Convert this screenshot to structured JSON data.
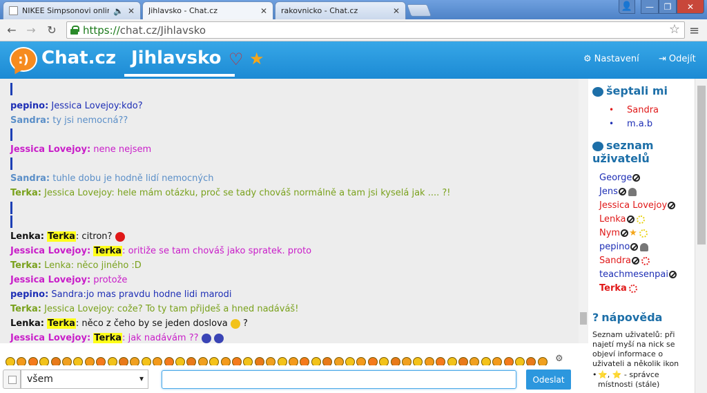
{
  "browser": {
    "tabs": [
      {
        "title": "NIKEE Simpsonovi online l"
      },
      {
        "title": "Jihlavsko - Chat.cz"
      },
      {
        "title": "rakovnicko - Chat.cz"
      }
    ],
    "url_scheme": "https://",
    "url_rest": "chat.cz/Jihlavsko"
  },
  "header": {
    "logo_symbol": ":)",
    "logo": "Chat.cz",
    "room": "Jihlavsko",
    "settings": "Nastavení",
    "logout": "Odejít"
  },
  "colors": {
    "header": "#1c8ad4",
    "pepino": "#1d2eb5",
    "sandra": "#5b8fc8",
    "jessica": "#c91ec9",
    "terka": "#79a11c",
    "lenka": "#111111",
    "highlight": "#ffff1a"
  },
  "messages": [
    {
      "nick": "pepino:",
      "text": "Jessica Lovejoy:kdo?"
    },
    {
      "nick": "Sandra:",
      "text": "ty jsi nemocná??"
    },
    {
      "nick": "Jessica Lovejoy:",
      "text": "nene nejsem"
    },
    {
      "nick": "Sandra:",
      "text": "tuhle dobu je hodně lidí nemocných"
    },
    {
      "nick": "Terka:",
      "text": "Jessica Lovejoy: hele mám otázku, proč se tady chováš normálně a tam jsi kyselá jak .... ?!"
    },
    {
      "nick": "Lenka:",
      "target": "Terka",
      "text": ": citron?"
    },
    {
      "nick": "Jessica Lovejoy:",
      "target": "Terka",
      "text": ": oritiže se tam chováš jako spratek. proto"
    },
    {
      "nick": "Terka:",
      "text": "Lenka: něco jiného :D"
    },
    {
      "nick": "Jessica Lovejoy:",
      "text": "protože"
    },
    {
      "nick": "pepino:",
      "text": "Sandra:jo mas pravdu hodne lidi marodi"
    },
    {
      "nick": "Terka:",
      "text": "Jessica Lovejoy: cože? To ty tam přijdeš a hned nadáváš!"
    },
    {
      "nick": "Lenka:",
      "target": "Terka",
      "text": ": něco z čeho by se jeden doslova",
      "tail": "?"
    },
    {
      "nick": "Jessica Lovejoy:",
      "target": "Terka",
      "text": ": jak nadávám ??"
    }
  ],
  "sidebar": {
    "whispers_title": "šeptali mi",
    "whispers": [
      "Sandra",
      "m.a.b"
    ],
    "users_title_1": "seznam",
    "users_title_2": "uživatelů",
    "users": [
      "George",
      "Jens",
      "Jessica Lovejoy",
      "Lenka",
      "Nym",
      "pepino",
      "Sandra",
      "teachmesenpai",
      "Terka"
    ],
    "help_title": "nápověda",
    "help_text": "Seznam uživatelů: při najetí myší na nick se objeví informace o uživateli a několik ikon",
    "help_item": "⭐, ⭐ - správce místnosti (stále)"
  },
  "input": {
    "recipient": "všem",
    "message": "",
    "send": "Odeslat"
  }
}
